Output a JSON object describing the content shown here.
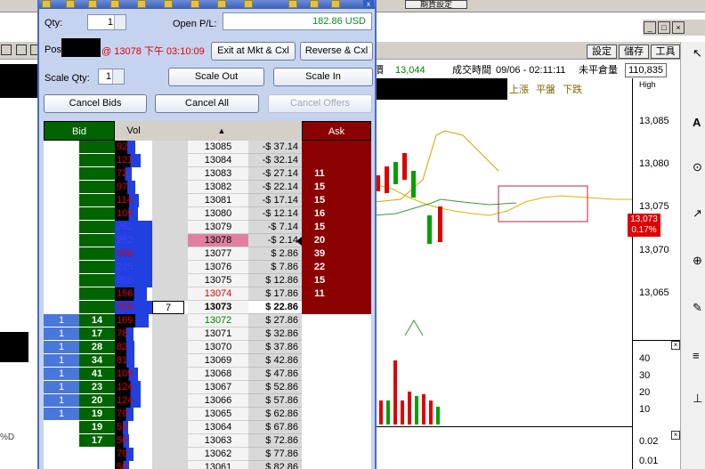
{
  "background": {
    "top_button_label": "期貨設定",
    "toolbar_buttons": [
      "設定",
      "儲存",
      "工具"
    ],
    "win_controls": [
      "_",
      "□",
      "×"
    ],
    "quote": {
      "price_label": "價",
      "price": "13,044",
      "time_label": "成交時間",
      "time": "09/06 - 02:11:11",
      "oi_label": "未平倉量",
      "oi": "110,835"
    },
    "legend": [
      "上漲",
      "平盤",
      "下跌"
    ],
    "legend_top": "High",
    "axis_labels": [
      "13,085",
      "13,080",
      "13,075",
      "13,070",
      "13,065"
    ],
    "price_badge": [
      "13,073",
      "0.17%"
    ],
    "sub_axis_labels": [
      "40",
      "30",
      "20",
      "10"
    ],
    "sub2_axis_labels": [
      "0.02",
      "0.01"
    ],
    "left_label": "%D",
    "right_tools": [
      "↖",
      "A",
      "⊙",
      "↗",
      "⊕",
      "✎",
      "≡",
      "⊥"
    ]
  },
  "window": {
    "qty_label": "Qty:",
    "qty_value": "1",
    "open_pl_label": "Open P/L:",
    "open_pl_value": "182.86 USD",
    "pos_label": "Pos",
    "pos_time": "@ 13078 下午 03:10:09",
    "exit_button": "Exit at Mkt & Cxl",
    "reverse_button": "Reverse & Cxl",
    "scale_qty_label": "Scale Qty:",
    "scale_qty_value": "1",
    "scale_out_button": "Scale Out",
    "scale_in_button": "Scale In",
    "cancel_bids_button": "Cancel Bids",
    "cancel_all_button": "Cancel All",
    "cancel_offers_button": "Cancel Offers",
    "close_glyph": "x"
  },
  "ladder": {
    "headers": {
      "bid": "Bid",
      "vol": "Vol",
      "sort": "▲",
      "ask": "Ask"
    },
    "rows": [
      {
        "bq": "",
        "bs": "",
        "vol": "92",
        "vol_pct": 0.55,
        "vol_color": "#e00000",
        "price": "13085",
        "price_color": "#000",
        "pl": "-$ 37.14",
        "ask": "",
        "bold": false,
        "hl": false,
        "order": ""
      },
      {
        "bq": "",
        "bs": "",
        "vol": "121",
        "vol_pct": 0.7,
        "vol_color": "#e00000",
        "price": "13084",
        "price_color": "#000",
        "pl": "-$ 32.14",
        "ask": "",
        "bold": false,
        "hl": false,
        "order": ""
      },
      {
        "bq": "",
        "bs": "",
        "vol": "72",
        "vol_pct": 0.45,
        "vol_color": "#e00000",
        "price": "13083",
        "price_color": "#000",
        "pl": "-$ 27.14",
        "ask": "11",
        "bold": false,
        "hl": false,
        "order": ""
      },
      {
        "bq": "",
        "bs": "",
        "vol": "97",
        "vol_pct": 0.55,
        "vol_color": "#e00000",
        "price": "13082",
        "price_color": "#000",
        "pl": "-$ 22.14",
        "ask": "15",
        "bold": false,
        "hl": false,
        "order": ""
      },
      {
        "bq": "",
        "bs": "",
        "vol": "114",
        "vol_pct": 0.65,
        "vol_color": "#e00000",
        "price": "13081",
        "price_color": "#000",
        "pl": "-$ 17.14",
        "ask": "15",
        "bold": false,
        "hl": false,
        "order": ""
      },
      {
        "bq": "",
        "bs": "",
        "vol": "109",
        "vol_pct": 0.63,
        "vol_color": "#e00000",
        "price": "13080",
        "price_color": "#000",
        "pl": "-$ 12.14",
        "ask": "16",
        "bold": false,
        "hl": false,
        "order": ""
      },
      {
        "bq": "",
        "bs": "",
        "vol": "262",
        "vol_pct": 1.0,
        "vol_color": "#4040ff",
        "price": "13079",
        "price_color": "#000",
        "pl": "-$ 7.14",
        "ask": "15",
        "bold": false,
        "hl": false,
        "order": ""
      },
      {
        "bq": "",
        "bs": "",
        "vol": "252",
        "vol_pct": 1.0,
        "vol_color": "#4040ff",
        "price": "13078",
        "price_color": "#000",
        "pl": "-$ 2.14",
        "ask": "20",
        "bold": false,
        "hl": true,
        "order": ""
      },
      {
        "bq": "",
        "bs": "",
        "vol": "206",
        "vol_pct": 1.0,
        "vol_color": "#e00000",
        "price": "13077",
        "price_color": "#000",
        "pl": "$ 2.86",
        "ask": "39",
        "bold": false,
        "hl": false,
        "order": ""
      },
      {
        "bq": "",
        "bs": "",
        "vol": "225",
        "vol_pct": 1.0,
        "vol_color": "#4040ff",
        "price": "13076",
        "price_color": "#000",
        "pl": "$ 7.86",
        "ask": "22",
        "bold": false,
        "hl": false,
        "order": ""
      },
      {
        "bq": "",
        "bs": "",
        "vol": "208",
        "vol_pct": 1.0,
        "vol_color": "#4040ff",
        "price": "13075",
        "price_color": "#000",
        "pl": "$ 12.86",
        "ask": "15",
        "bold": false,
        "hl": false,
        "order": ""
      },
      {
        "bq": "",
        "bs": "",
        "vol": "156",
        "vol_pct": 0.85,
        "vol_color": "#e00000",
        "price": "13074",
        "price_color": "#e00000",
        "pl": "$ 17.86",
        "ask": "11",
        "bold": false,
        "hl": false,
        "order": ""
      },
      {
        "bq": "",
        "bs": "",
        "vol": "200",
        "vol_pct": 1.0,
        "vol_color": "#e00000",
        "price": "13073",
        "price_color": "#000",
        "pl": "$ 22.86",
        "ask": "",
        "bold": true,
        "hl": false,
        "order": "7"
      },
      {
        "bq": "1",
        "bs": "14",
        "vol": "169",
        "vol_pct": 0.9,
        "vol_color": "#e00000",
        "price": "13072",
        "price_color": "#008000",
        "pl": "$ 27.86",
        "ask": "",
        "bold": false,
        "hl": false,
        "order": ""
      },
      {
        "bq": "1",
        "bs": "17",
        "vol": "78",
        "vol_pct": 0.5,
        "vol_color": "#e00000",
        "price": "13071",
        "price_color": "#000",
        "pl": "$ 32.86",
        "ask": "",
        "bold": false,
        "hl": false,
        "order": ""
      },
      {
        "bq": "1",
        "bs": "28",
        "vol": "82",
        "vol_pct": 0.52,
        "vol_color": "#e00000",
        "price": "13070",
        "price_color": "#000",
        "pl": "$ 37.86",
        "ask": "",
        "bold": false,
        "hl": false,
        "order": ""
      },
      {
        "bq": "1",
        "bs": "34",
        "vol": "81",
        "vol_pct": 0.52,
        "vol_color": "#e00000",
        "price": "13069",
        "price_color": "#000",
        "pl": "$ 42.86",
        "ask": "",
        "bold": false,
        "hl": false,
        "order": ""
      },
      {
        "bq": "1",
        "bs": "41",
        "vol": "109",
        "vol_pct": 0.63,
        "vol_color": "#e00000",
        "price": "13068",
        "price_color": "#000",
        "pl": "$ 47.86",
        "ask": "",
        "bold": false,
        "hl": false,
        "order": ""
      },
      {
        "bq": "1",
        "bs": "23",
        "vol": "124",
        "vol_pct": 0.7,
        "vol_color": "#e00000",
        "price": "13067",
        "price_color": "#000",
        "pl": "$ 52.86",
        "ask": "",
        "bold": false,
        "hl": false,
        "order": ""
      },
      {
        "bq": "1",
        "bs": "20",
        "vol": "124",
        "vol_pct": 0.7,
        "vol_color": "#e00000",
        "price": "13066",
        "price_color": "#000",
        "pl": "$ 57.86",
        "ask": "",
        "bold": false,
        "hl": false,
        "order": ""
      },
      {
        "bq": "1",
        "bs": "19",
        "vol": "79",
        "vol_pct": 0.5,
        "vol_color": "#e00000",
        "price": "13065",
        "price_color": "#000",
        "pl": "$ 62.86",
        "ask": "",
        "bold": false,
        "hl": false,
        "order": ""
      },
      {
        "bq": "",
        "bs": "19",
        "vol": "52",
        "vol_pct": 0.35,
        "vol_color": "#e00000",
        "price": "13064",
        "price_color": "#000",
        "pl": "$ 67.86",
        "ask": "",
        "bold": false,
        "hl": false,
        "order": ""
      },
      {
        "bq": "",
        "bs": "17",
        "vol": "56",
        "vol_pct": 0.38,
        "vol_color": "#e00000",
        "price": "13063",
        "price_color": "#000",
        "pl": "$ 72.86",
        "ask": "",
        "bold": false,
        "hl": false,
        "order": ""
      },
      {
        "bq": "",
        "bs": "",
        "vol": "79",
        "vol_pct": 0.5,
        "vol_color": "#e00000",
        "price": "13062",
        "price_color": "#000",
        "pl": "$ 77.86",
        "ask": "",
        "bold": false,
        "hl": false,
        "order": ""
      },
      {
        "bq": "",
        "bs": "",
        "vol": "58",
        "vol_pct": 0.38,
        "vol_color": "#e00000",
        "price": "13061",
        "price_color": "#000",
        "pl": "$ 82.86",
        "ask": "",
        "bold": false,
        "hl": false,
        "order": ""
      }
    ]
  }
}
